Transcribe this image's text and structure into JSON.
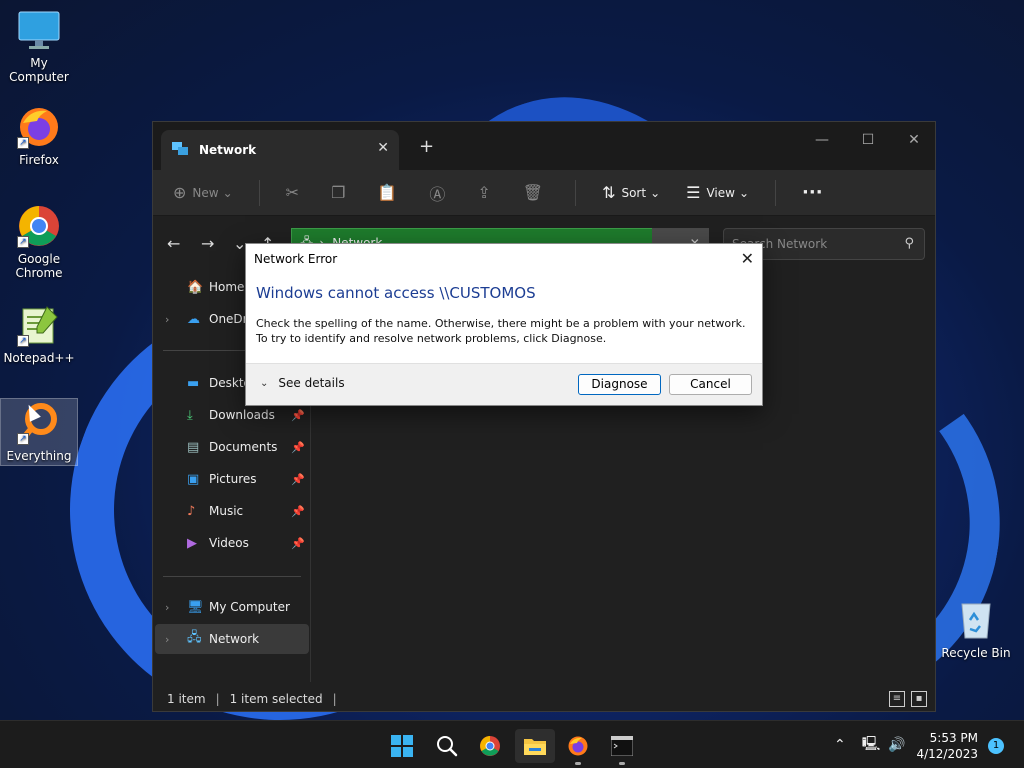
{
  "desktop": {
    "icons": [
      {
        "label": "My Computer"
      },
      {
        "label": "Firefox"
      },
      {
        "label": "Google Chrome"
      },
      {
        "label": "Notepad++"
      },
      {
        "label": "Everything"
      },
      {
        "label": "Recycle Bin"
      }
    ]
  },
  "explorer": {
    "tab_title": "Network",
    "tab_close": "✕",
    "new_tab": "+",
    "toolbar": {
      "new_label": "New",
      "sort_label": "Sort",
      "view_label": "View",
      "more_label": "···"
    },
    "address_text": "Network",
    "search_placeholder": "Search Network",
    "sidebar": {
      "home": "Home",
      "onedrive": "OneDrive",
      "desktop": "Desktop",
      "downloads": "Downloads",
      "documents": "Documents",
      "pictures": "Pictures",
      "music": "Music",
      "videos": "Videos",
      "my_computer": "My Computer",
      "network": "Network"
    },
    "status": {
      "items": "1 item",
      "selected": "1 item selected"
    }
  },
  "dialog": {
    "title": "Network Error",
    "heading": "Windows cannot access \\\\CUSTOMOS",
    "message": "Check the spelling of the name. Otherwise, there might be a problem with your network. To try to identify and resolve network problems, click Diagnose.",
    "see_details": "See details",
    "diagnose": "Diagnose",
    "cancel": "Cancel"
  },
  "taskbar": {
    "time": "5:53 PM",
    "date": "4/12/2023",
    "notification_count": "1"
  },
  "colors": {
    "accent": "#4cc2ff",
    "dialog_heading": "#1c3d93",
    "address_highlight": "#1e7b2c"
  }
}
